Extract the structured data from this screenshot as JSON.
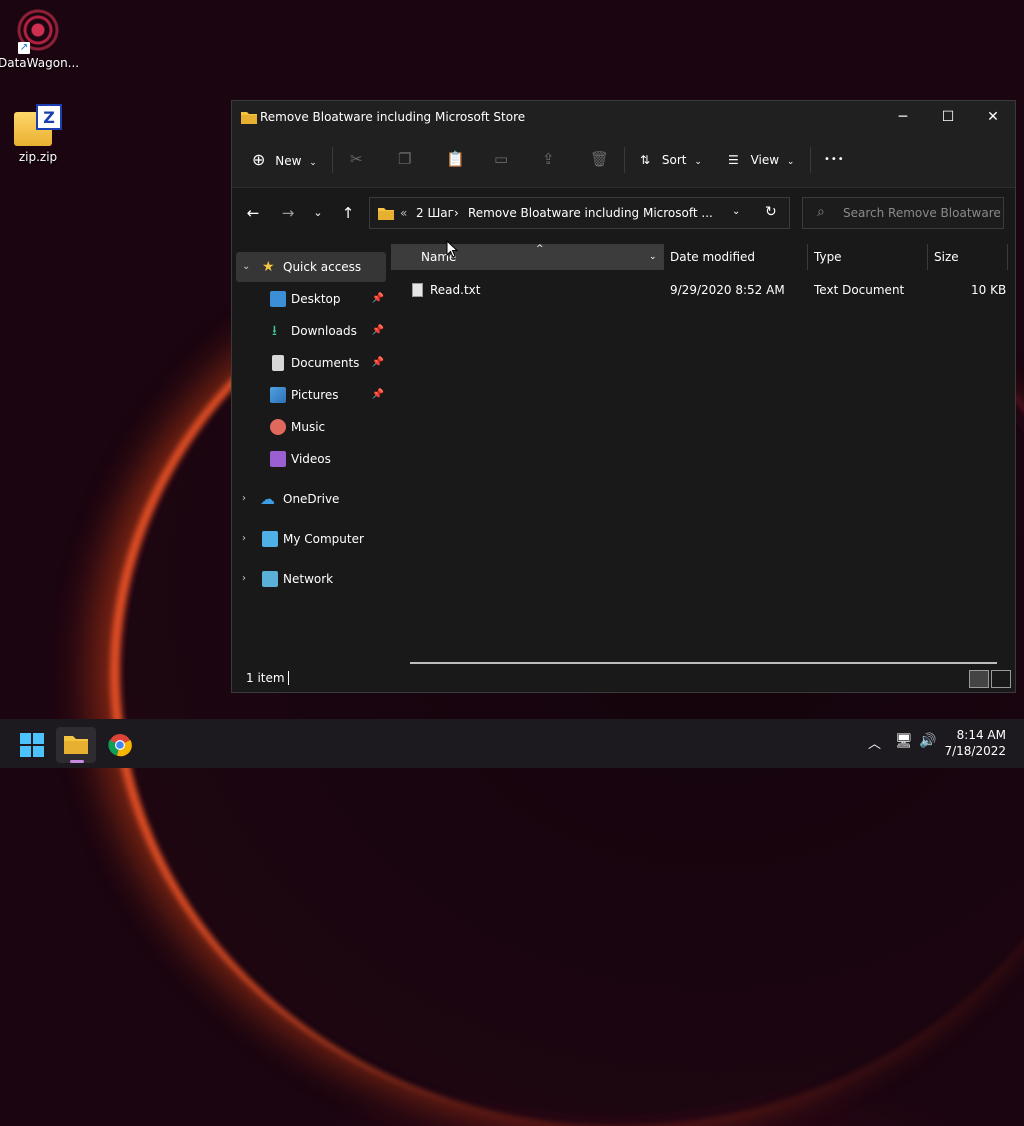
{
  "desktop": {
    "icons": [
      {
        "label": "DataWagon..."
      },
      {
        "label": "zip.zip"
      }
    ]
  },
  "window": {
    "title": "Remove Bloatware including Microsoft Store",
    "controls": {
      "minimize": "─",
      "maximize": "☐",
      "close": "✕"
    }
  },
  "toolbar": {
    "new_label": "New",
    "sort_label": "Sort",
    "view_label": "View",
    "more_label": "•••"
  },
  "address": {
    "overflow": "«",
    "crumbs": [
      "2 Шаг",
      "Remove Bloatware including Microsoft ..."
    ],
    "separator": "›"
  },
  "search": {
    "placeholder": "Search Remove Bloatware in..."
  },
  "sidebar": {
    "items": [
      {
        "label": "Quick access"
      },
      {
        "label": "Desktop"
      },
      {
        "label": "Downloads"
      },
      {
        "label": "Documents"
      },
      {
        "label": "Pictures"
      },
      {
        "label": "Music"
      },
      {
        "label": "Videos"
      },
      {
        "label": "OneDrive"
      },
      {
        "label": "My Computer"
      },
      {
        "label": "Network"
      }
    ]
  },
  "columns": {
    "name": "Name",
    "date": "Date modified",
    "type": "Type",
    "size": "Size"
  },
  "files": [
    {
      "name": "Read.txt",
      "date": "9/29/2020 8:52 AM",
      "type": "Text Document",
      "size": "10 KB"
    }
  ],
  "status": {
    "count": "1 item"
  },
  "clock": {
    "time": "8:14 AM",
    "date": "7/18/2022"
  },
  "colors": {
    "accent": "#60cdff",
    "folder": "#f5c542",
    "window_bg": "#191919",
    "selection": "#363636"
  }
}
